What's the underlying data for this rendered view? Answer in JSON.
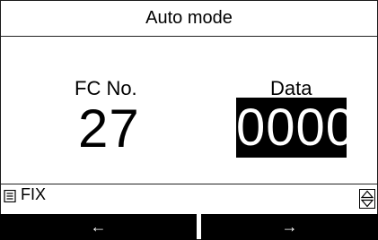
{
  "title": "Auto mode",
  "fields": {
    "fc_label": "FC No.",
    "fc_value": "27",
    "data_label": "Data",
    "data_value": "0000"
  },
  "status": {
    "menu_icon": "list-menu-icon",
    "fix_label": "FIX",
    "updown_icon": "up-down-arrows-icon"
  },
  "softkeys": {
    "left": "←",
    "right": "→"
  },
  "colors": {
    "background": "#ffffff",
    "foreground": "#000000",
    "highlight_bg": "#000000",
    "highlight_fg": "#ffffff"
  }
}
